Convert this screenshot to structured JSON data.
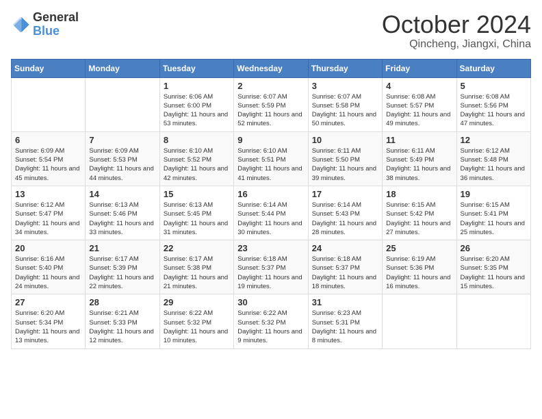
{
  "header": {
    "logo_general": "General",
    "logo_blue": "Blue",
    "month_title": "October 2024",
    "location": "Qincheng, Jiangxi, China"
  },
  "weekdays": [
    "Sunday",
    "Monday",
    "Tuesday",
    "Wednesday",
    "Thursday",
    "Friday",
    "Saturday"
  ],
  "weeks": [
    [
      {
        "day": "",
        "info": ""
      },
      {
        "day": "",
        "info": ""
      },
      {
        "day": "1",
        "info": "Sunrise: 6:06 AM\nSunset: 6:00 PM\nDaylight: 11 hours and 53 minutes."
      },
      {
        "day": "2",
        "info": "Sunrise: 6:07 AM\nSunset: 5:59 PM\nDaylight: 11 hours and 52 minutes."
      },
      {
        "day": "3",
        "info": "Sunrise: 6:07 AM\nSunset: 5:58 PM\nDaylight: 11 hours and 50 minutes."
      },
      {
        "day": "4",
        "info": "Sunrise: 6:08 AM\nSunset: 5:57 PM\nDaylight: 11 hours and 49 minutes."
      },
      {
        "day": "5",
        "info": "Sunrise: 6:08 AM\nSunset: 5:56 PM\nDaylight: 11 hours and 47 minutes."
      }
    ],
    [
      {
        "day": "6",
        "info": "Sunrise: 6:09 AM\nSunset: 5:54 PM\nDaylight: 11 hours and 45 minutes."
      },
      {
        "day": "7",
        "info": "Sunrise: 6:09 AM\nSunset: 5:53 PM\nDaylight: 11 hours and 44 minutes."
      },
      {
        "day": "8",
        "info": "Sunrise: 6:10 AM\nSunset: 5:52 PM\nDaylight: 11 hours and 42 minutes."
      },
      {
        "day": "9",
        "info": "Sunrise: 6:10 AM\nSunset: 5:51 PM\nDaylight: 11 hours and 41 minutes."
      },
      {
        "day": "10",
        "info": "Sunrise: 6:11 AM\nSunset: 5:50 PM\nDaylight: 11 hours and 39 minutes."
      },
      {
        "day": "11",
        "info": "Sunrise: 6:11 AM\nSunset: 5:49 PM\nDaylight: 11 hours and 38 minutes."
      },
      {
        "day": "12",
        "info": "Sunrise: 6:12 AM\nSunset: 5:48 PM\nDaylight: 11 hours and 36 minutes."
      }
    ],
    [
      {
        "day": "13",
        "info": "Sunrise: 6:12 AM\nSunset: 5:47 PM\nDaylight: 11 hours and 34 minutes."
      },
      {
        "day": "14",
        "info": "Sunrise: 6:13 AM\nSunset: 5:46 PM\nDaylight: 11 hours and 33 minutes."
      },
      {
        "day": "15",
        "info": "Sunrise: 6:13 AM\nSunset: 5:45 PM\nDaylight: 11 hours and 31 minutes."
      },
      {
        "day": "16",
        "info": "Sunrise: 6:14 AM\nSunset: 5:44 PM\nDaylight: 11 hours and 30 minutes."
      },
      {
        "day": "17",
        "info": "Sunrise: 6:14 AM\nSunset: 5:43 PM\nDaylight: 11 hours and 28 minutes."
      },
      {
        "day": "18",
        "info": "Sunrise: 6:15 AM\nSunset: 5:42 PM\nDaylight: 11 hours and 27 minutes."
      },
      {
        "day": "19",
        "info": "Sunrise: 6:15 AM\nSunset: 5:41 PM\nDaylight: 11 hours and 25 minutes."
      }
    ],
    [
      {
        "day": "20",
        "info": "Sunrise: 6:16 AM\nSunset: 5:40 PM\nDaylight: 11 hours and 24 minutes."
      },
      {
        "day": "21",
        "info": "Sunrise: 6:17 AM\nSunset: 5:39 PM\nDaylight: 11 hours and 22 minutes."
      },
      {
        "day": "22",
        "info": "Sunrise: 6:17 AM\nSunset: 5:38 PM\nDaylight: 11 hours and 21 minutes."
      },
      {
        "day": "23",
        "info": "Sunrise: 6:18 AM\nSunset: 5:37 PM\nDaylight: 11 hours and 19 minutes."
      },
      {
        "day": "24",
        "info": "Sunrise: 6:18 AM\nSunset: 5:37 PM\nDaylight: 11 hours and 18 minutes."
      },
      {
        "day": "25",
        "info": "Sunrise: 6:19 AM\nSunset: 5:36 PM\nDaylight: 11 hours and 16 minutes."
      },
      {
        "day": "26",
        "info": "Sunrise: 6:20 AM\nSunset: 5:35 PM\nDaylight: 11 hours and 15 minutes."
      }
    ],
    [
      {
        "day": "27",
        "info": "Sunrise: 6:20 AM\nSunset: 5:34 PM\nDaylight: 11 hours and 13 minutes."
      },
      {
        "day": "28",
        "info": "Sunrise: 6:21 AM\nSunset: 5:33 PM\nDaylight: 11 hours and 12 minutes."
      },
      {
        "day": "29",
        "info": "Sunrise: 6:22 AM\nSunset: 5:32 PM\nDaylight: 11 hours and 10 minutes."
      },
      {
        "day": "30",
        "info": "Sunrise: 6:22 AM\nSunset: 5:32 PM\nDaylight: 11 hours and 9 minutes."
      },
      {
        "day": "31",
        "info": "Sunrise: 6:23 AM\nSunset: 5:31 PM\nDaylight: 11 hours and 8 minutes."
      },
      {
        "day": "",
        "info": ""
      },
      {
        "day": "",
        "info": ""
      }
    ]
  ]
}
